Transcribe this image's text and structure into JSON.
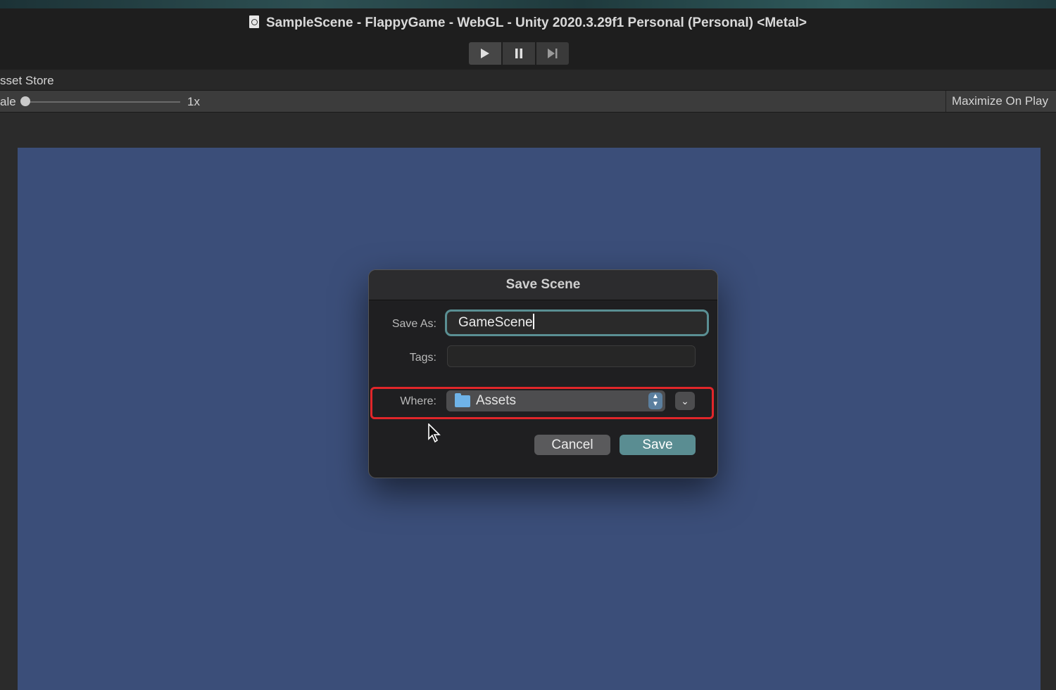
{
  "window": {
    "title": "SampleScene - FlappyGame - WebGL - Unity 2020.3.29f1 Personal (Personal) <Metal>"
  },
  "toolbar": {
    "play_icon": "play-icon",
    "pause_icon": "pause-icon",
    "step_icon": "step-icon"
  },
  "tabbar": {
    "label": "sset Store"
  },
  "gamebar": {
    "scale_label": "ale",
    "scale_value": "1x",
    "maximize_label": "Maximize On Play"
  },
  "dialog": {
    "title": "Save Scene",
    "save_as_label": "Save As:",
    "save_as_value": "GameScene",
    "tags_label": "Tags:",
    "tags_value": "",
    "where_label": "Where:",
    "where_value": "Assets",
    "cancel_label": "Cancel",
    "save_label": "Save"
  },
  "colors": {
    "scene_bg": "#3b4e79",
    "highlight": "#e1262a",
    "accent": "#5a8d92"
  }
}
